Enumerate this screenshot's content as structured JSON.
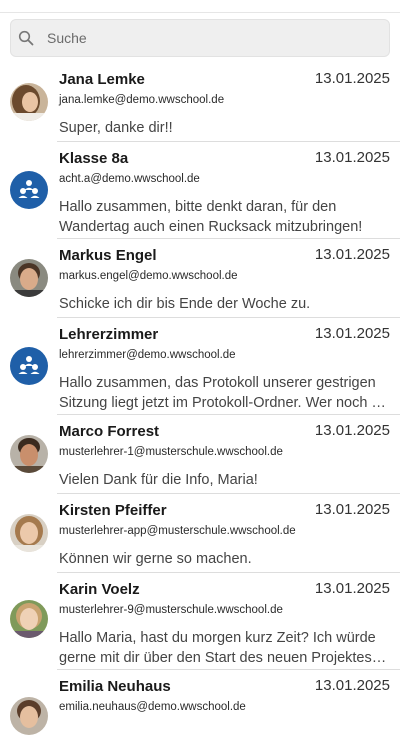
{
  "search": {
    "placeholder": "Suche"
  },
  "conversations": [
    {
      "name": "Jana Lemke",
      "date": "13.01.2025",
      "email": "jana.lemke@demo.wwschool.de",
      "message": "Super, danke dir!!",
      "avatar": "photo"
    },
    {
      "name": "Klasse 8a",
      "date": "13.01.2025",
      "email": "acht.a@demo.wwschool.de",
      "message": "Hallo zusammen, bitte denkt daran, für den Wandertag auch einen Rucksack mitzubringen!",
      "avatar": "group"
    },
    {
      "name": "Markus Engel",
      "date": "13.01.2025",
      "email": "markus.engel@demo.wwschool.de",
      "message": "Schicke ich dir bis Ende der Woche zu.",
      "avatar": "photo"
    },
    {
      "name": "Lehrerzimmer",
      "date": "13.01.2025",
      "email": "lehrerzimmer@demo.wwschool.de",
      "message": "Hallo zusammen, das Protokoll unserer gestrigen Sitzung liegt jetzt im Protokoll-Ordner. Wer noch …",
      "avatar": "group"
    },
    {
      "name": "Marco Forrest",
      "date": "13.01.2025",
      "email": "musterlehrer-1@musterschule.wwschool.de",
      "message": "Vielen Dank für die Info, Maria!",
      "avatar": "photo"
    },
    {
      "name": "Kirsten Pfeiffer",
      "date": "13.01.2025",
      "email": "musterlehrer-app@musterschule.wwschool.de",
      "message": "Können wir gerne so machen.",
      "avatar": "photo"
    },
    {
      "name": "Karin Voelz",
      "date": "13.01.2025",
      "email": "musterlehrer-9@musterschule.wwschool.de",
      "message": "Hallo Maria, hast du morgen kurz Zeit? Ich würde gerne mit dir über den Start des neuen Projektes …",
      "avatar": "photo"
    },
    {
      "name": "Emilia Neuhaus",
      "date": "13.01.2025",
      "email": "emilia.neuhaus@demo.wwschool.de",
      "message": "",
      "avatar": "photo"
    }
  ],
  "colors": {
    "group_avatar": "#1f5fa8",
    "divider": "#dddddd",
    "search_bg": "#efefef"
  }
}
